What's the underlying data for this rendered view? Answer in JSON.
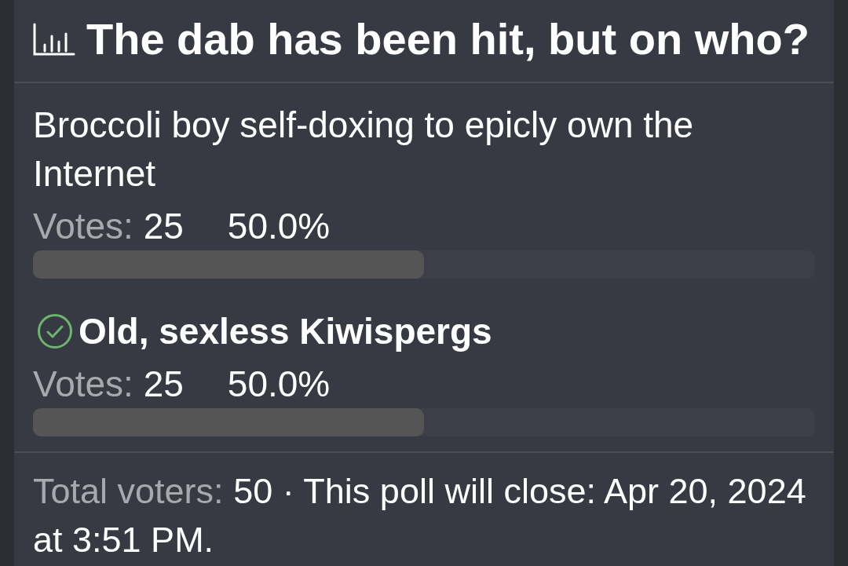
{
  "poll": {
    "title": "The dab has been hit, but on who?",
    "options": [
      {
        "label": "Broccoli boy self-doxing to epicly own the Internet",
        "selected": false,
        "votes_label": "Votes:",
        "votes": "25",
        "percent": "50.0%",
        "level": 0.5
      },
      {
        "label": "Old, sexless Kiwispergs",
        "selected": true,
        "votes_label": "Votes:",
        "votes": "25",
        "percent": "50.0%",
        "level": 0.5
      }
    ],
    "footer": {
      "total_label": "Total voters:",
      "text": "50 · This poll will close: Apr 20, 2024 at 3:51 PM."
    }
  }
}
